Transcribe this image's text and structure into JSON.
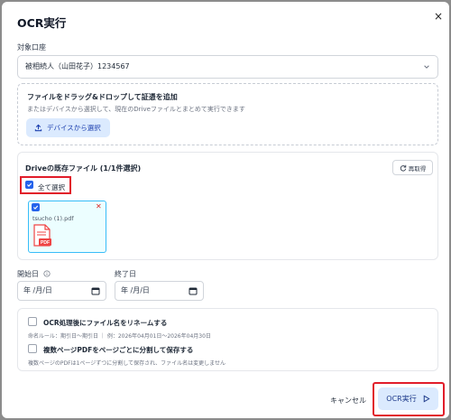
{
  "dialog": {
    "title": "OCR実行",
    "close_symbol": "×"
  },
  "account": {
    "label": "対象口座",
    "selected": "被相続人（山田花子）1234567"
  },
  "upload": {
    "title": "ファイルをドラッグ&ドロップして証憑を追加",
    "description": "またはデバイスから選択して、現在のDriveファイルとまとめて実行できます",
    "device_button": "デバイスから選択"
  },
  "drive": {
    "title": "Driveの既存ファイル (1/1件選択)",
    "refetch_button": "再取得",
    "select_all_label": "全て選択",
    "select_all_checked": true,
    "files": [
      {
        "name": "tsucho (1).pdf",
        "checked": true,
        "badge": "PDF"
      }
    ]
  },
  "dates": {
    "start_label": "開始日",
    "start_placeholder": "年 /月/日",
    "end_label": "終了日",
    "end_placeholder": "年 /月/日"
  },
  "options": {
    "rename_title": "OCR処理後にファイル名をリネームする",
    "rename_desc": "命名ルール：期引日～期引日 ｜ 例：2026年04月01日～2026年04月30日",
    "split_title": "複数ページPDFをページごとに分割して保存する",
    "split_desc": "複数ページのPDFは1ページずつに分割して保存され、ファイル名は変更しません"
  },
  "footer": {
    "cancel_label": "キャンセル",
    "run_label": "OCR実行"
  },
  "colors": {
    "accent": "#2563eb",
    "highlight": "#e11d2a",
    "button_bg": "#dbeafe",
    "file_card_bg": "#ecfeff"
  }
}
